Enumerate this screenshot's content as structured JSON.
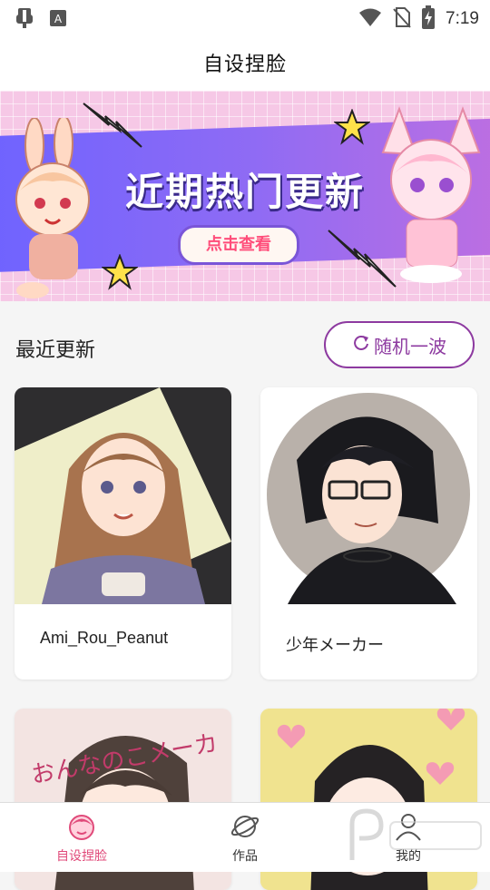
{
  "status_bar": {
    "time": "7:19",
    "left_icons": [
      "bug-icon",
      "keyboard-a-icon"
    ],
    "right_icons": [
      "wifi-icon",
      "no-sim-icon",
      "battery-charging-icon"
    ]
  },
  "app_bar": {
    "title": "自设捏脸"
  },
  "banner": {
    "headline": "近期热门更新",
    "button_label": "点击查看"
  },
  "recent": {
    "title": "最近更新",
    "random_button_label": "随机一波",
    "random_icon": "refresh-icon",
    "cards": [
      {
        "label": "Ami_Rou_Peanut",
        "image": "portrait-curly-hair"
      },
      {
        "label": "少年メーカー",
        "image": "portrait-boy-glasses"
      },
      {
        "label": "",
        "image": "portrait-twin-tails",
        "image_text": "おんなのこメーカー"
      },
      {
        "label": "",
        "image": "portrait-short-hair-hearts"
      }
    ]
  },
  "bottom_nav": {
    "items": [
      {
        "label": "自设捏脸",
        "icon": "face-icon",
        "active": true
      },
      {
        "label": "作品",
        "icon": "planet-icon",
        "active": false
      },
      {
        "label": "我的",
        "icon": "person-icon",
        "active": false
      }
    ]
  },
  "colors": {
    "accent": "#8d3aa0",
    "active_nav": "#e04a7a",
    "banner_band": "#7a66ff",
    "banner_bg": "#f6c8e6"
  }
}
